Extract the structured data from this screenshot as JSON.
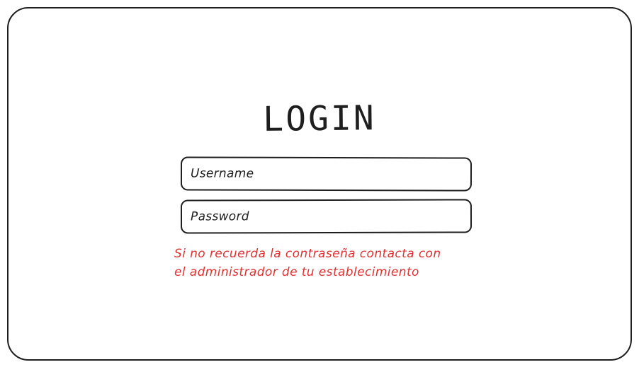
{
  "login": {
    "title": "LOGIN",
    "username": {
      "placeholder": "Username"
    },
    "password": {
      "placeholder": "Password"
    },
    "notice": {
      "line1": "Si no recuerda la contraseña contacta con",
      "line2": "el administrador de tu establecimiento",
      "color": "#e03131"
    }
  }
}
